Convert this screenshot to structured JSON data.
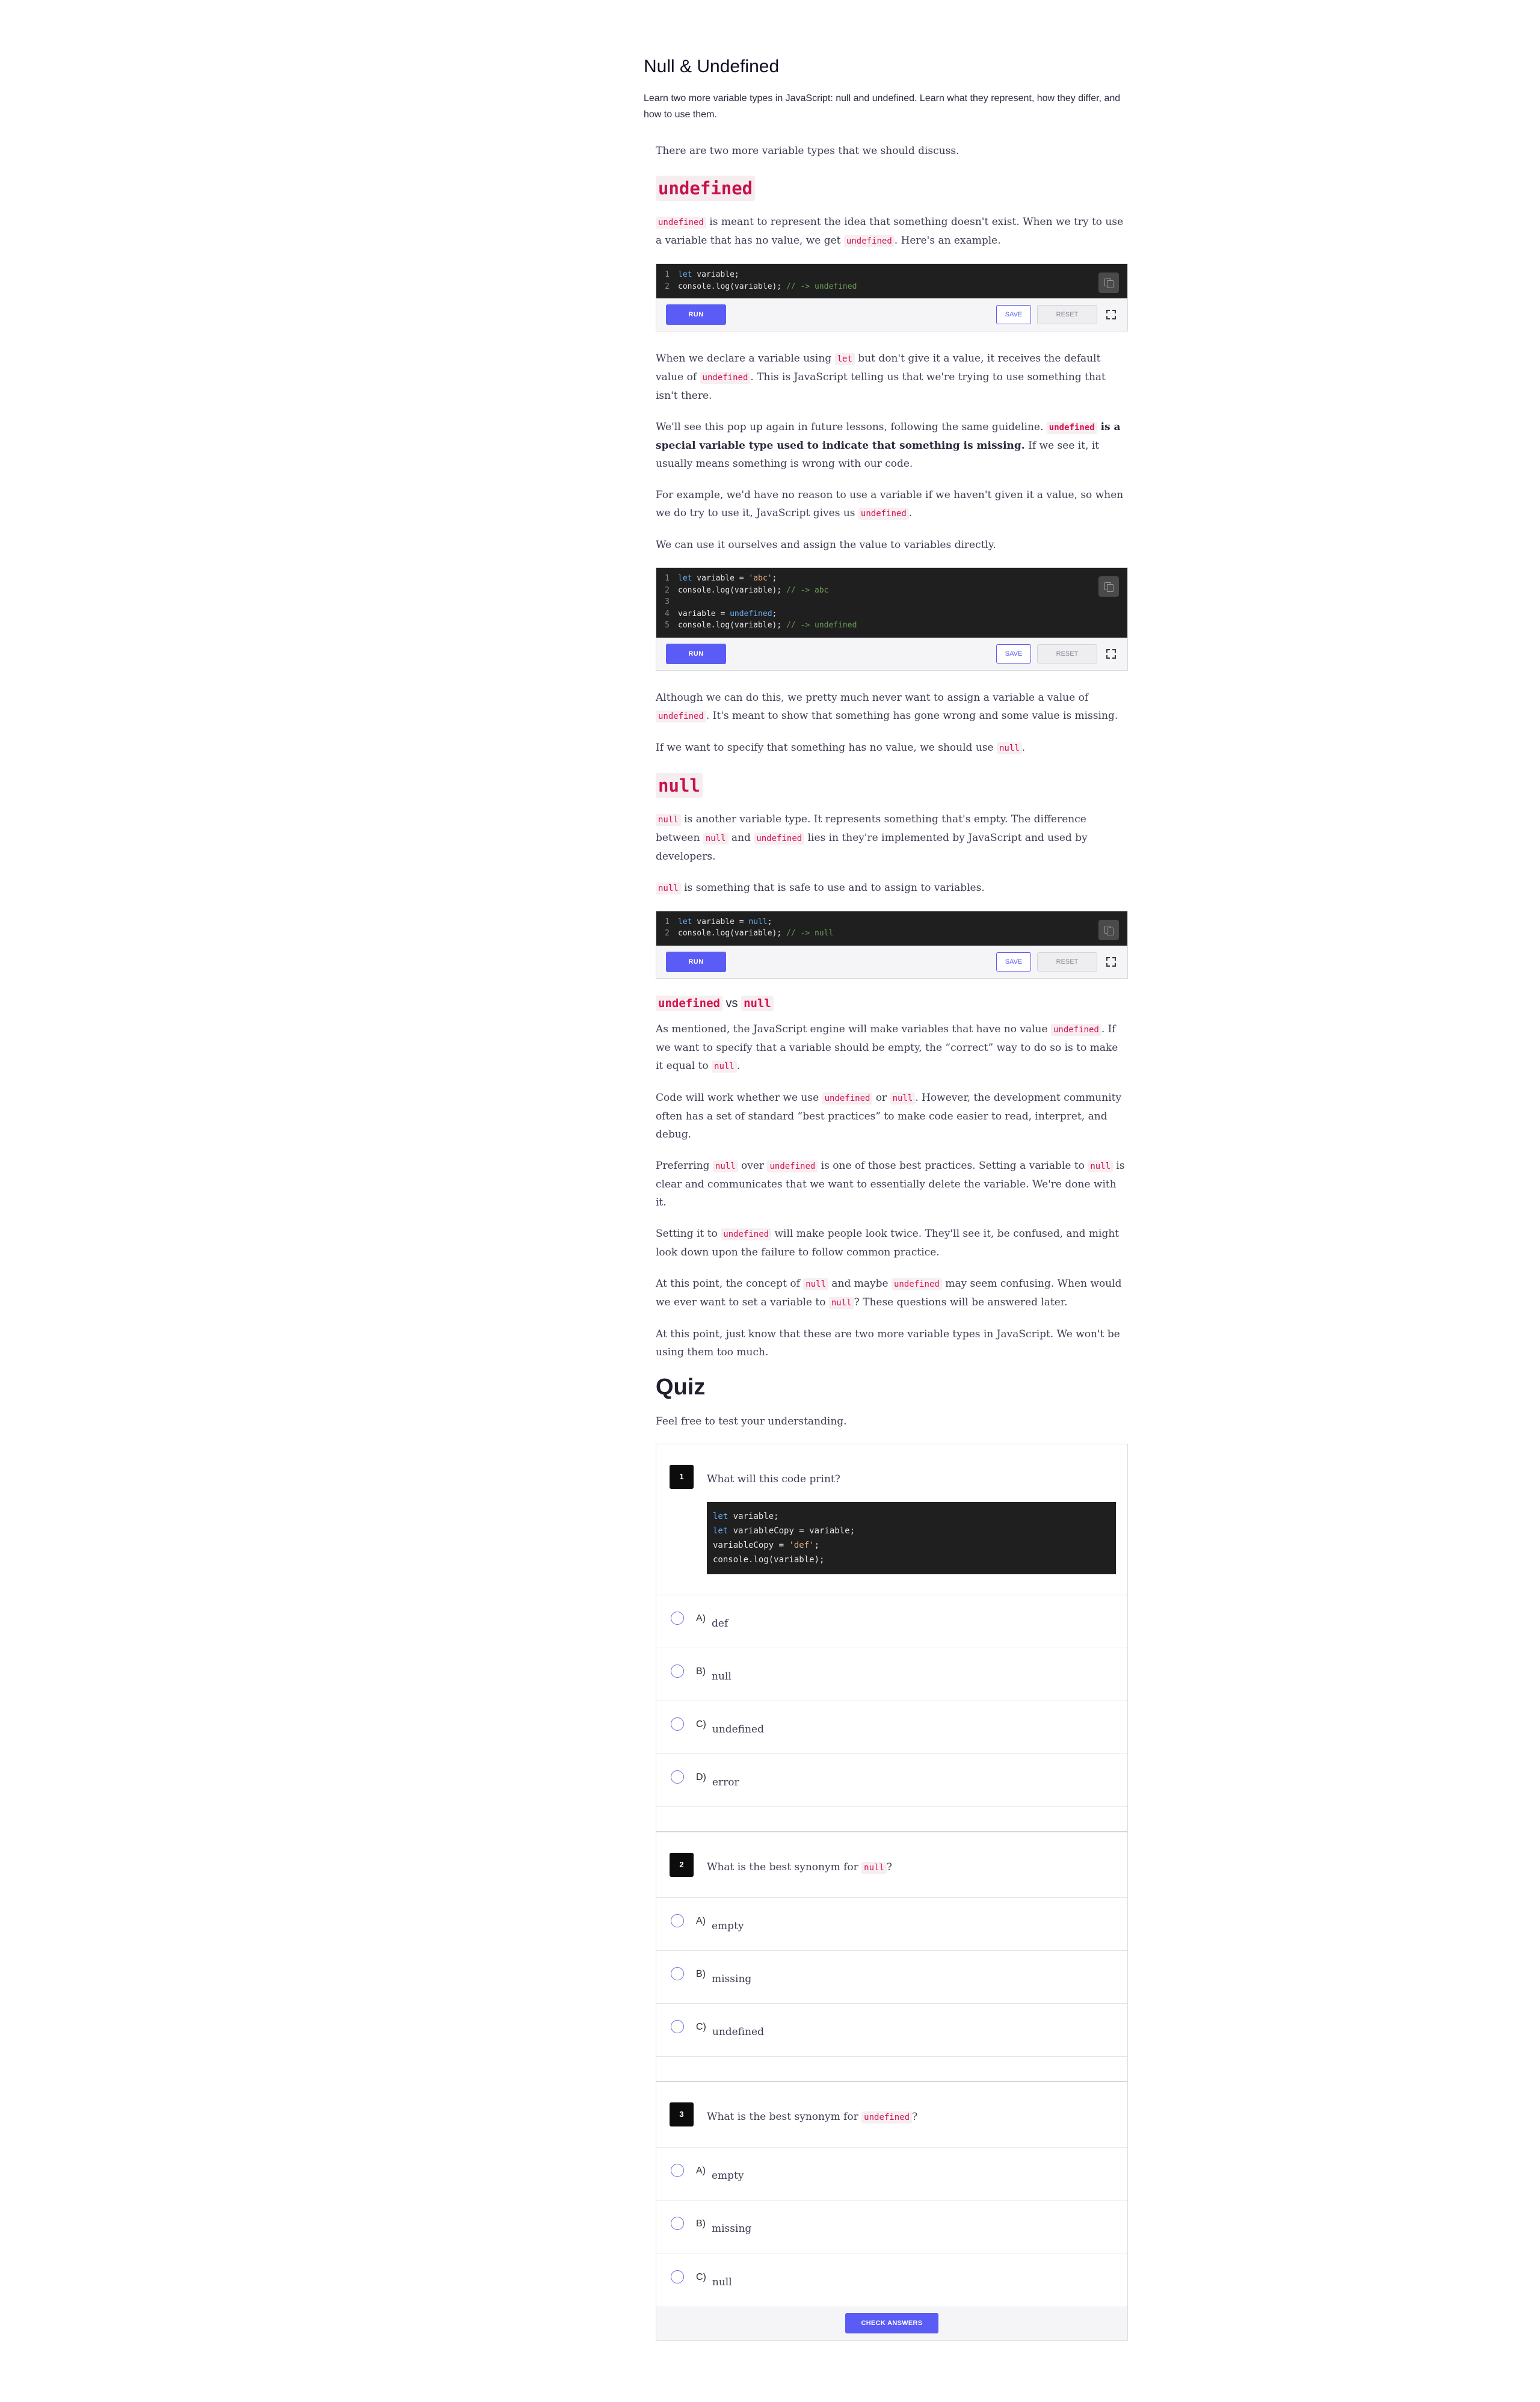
{
  "header": {
    "title": "Null & Undefined",
    "subtitle": "Learn two more variable types in JavaScript: null and undefined. Learn what they represent, how they differ, and how to use them."
  },
  "intro": "There are two more variable types that we should discuss.",
  "undefined_section": {
    "heading": "undefined",
    "p1": {
      "c1": "undefined",
      "t1": " is meant to represent the idea that something doesn't exist. When we try to use a variable that has no value, we get ",
      "c2": "undefined",
      "t2": ". Here's an example."
    }
  },
  "editor_labels": {
    "run": "RUN",
    "save": "SAVE",
    "reset": "RESET"
  },
  "editor1": {
    "lines": [
      {
        "n": "1",
        "kw": "let",
        "rest": " variable;",
        "cm": ""
      },
      {
        "n": "2",
        "kw": "",
        "rest": "console.log(variable); ",
        "cm": "// -> undefined"
      }
    ]
  },
  "paragraphs_a": {
    "p2": {
      "t1": "When we declare a variable using ",
      "c1": "let",
      "t2": " but don't give it a value, it receives the default value of ",
      "c2": "undefined",
      "t3": ". This is JavaScript telling us that we're trying to use something that isn't there."
    },
    "p3": {
      "t1": "We'll see this pop up again in future lessons, following the same guideline. ",
      "c1": "undefined",
      "b1": " is a special variable type used to indicate that something is missing.",
      "t2": " If we see it, it usually means something is wrong with our code."
    },
    "p4": {
      "t1": "For example, we'd have no reason to use a variable if we haven't given it a value, so when we do try to use it, JavaScript gives us ",
      "c1": "undefined",
      "t2": "."
    },
    "p5": "We can use it ourselves and assign the value to variables directly."
  },
  "editor2": {
    "l1": {
      "n": "1",
      "kw": "let",
      "a": " variable = ",
      "s": "'abc'",
      "b": ";"
    },
    "l2": {
      "n": "2",
      "a": "console.log(variable); ",
      "cm": "// -> abc"
    },
    "l3": {
      "n": "3"
    },
    "l4": {
      "n": "4",
      "a": "variable = ",
      "kw": "undefined",
      "b": ";"
    },
    "l5": {
      "n": "5",
      "a": "console.log(variable); ",
      "cm": "// -> undefined"
    }
  },
  "paragraphs_b": {
    "p6": {
      "t1": "Although we can do this, we pretty much never want to assign a variable a value of ",
      "c1": "undefined",
      "t2": ". It's meant to show that something has gone wrong and some value is missing."
    },
    "p7": {
      "t1": "If we want to specify that something has no value, we should use ",
      "c1": "null",
      "t2": "."
    }
  },
  "null_section": {
    "heading": "null",
    "p1": {
      "c1": "null",
      "t1": " is another variable type. It represents something that's empty. The difference between ",
      "c2": "null",
      "t2": " and ",
      "c3": "undefined",
      "t3": " lies in they're implemented by JavaScript and used by developers."
    },
    "p2": {
      "c1": "null",
      "t1": " is something that is safe to use and to assign to variables."
    }
  },
  "editor3": {
    "l1": {
      "n": "1",
      "kw": "let",
      "a": " variable = ",
      "kw2": "null",
      "b": ";"
    },
    "l2": {
      "n": "2",
      "a": "console.log(variable); ",
      "cm": "// -> null"
    }
  },
  "vs_section": {
    "c1": "undefined",
    "vs": " vs ",
    "c2": "null",
    "p1": {
      "t1": "As mentioned, the JavaScript engine will make variables that have no value ",
      "c1": "undefined",
      "t2": ". If we want to specify that a variable should be empty, the “correct” way to do so is to make it equal to ",
      "c2": "null",
      "t3": "."
    },
    "p2": {
      "t1": "Code will work whether we use ",
      "c1": "undefined",
      "t2": " or ",
      "c2": "null",
      "t3": ". However, the development community often has a set of standard “best practices” to make code easier to read, interpret, and debug."
    },
    "p3": {
      "t1": "Preferring ",
      "c1": "null",
      "t2": " over ",
      "c2": "undefined",
      "t3": " is one of those best practices. Setting a variable to ",
      "c3": "null",
      "t4": " is clear and communicates that we want to essentially delete the variable. We're done with it."
    },
    "p4": {
      "t1": "Setting it to ",
      "c1": "undefined",
      "t2": " will make people look twice. They'll see it, be confused, and might look down upon the failure to follow common practice."
    },
    "p5": {
      "t1": "At this point, the concept of ",
      "c1": "null",
      "t2": " and maybe ",
      "c2": "undefined",
      "t3": " may seem confusing. When would we ever want to set a variable to ",
      "c3": "null",
      "t4": "? These questions will be answered later."
    },
    "p6": "At this point, just know that these are two more variable types in JavaScript. We won't be using them too much."
  },
  "quiz": {
    "title": "Quiz",
    "intro": "Feel free to test your understanding.",
    "q1": {
      "num": "1",
      "text": "What will this code print?",
      "code": {
        "l1": {
          "kw": "let",
          "a": " variable;"
        },
        "l2": {
          "kw": "let",
          "a": " variableCopy = variable;"
        },
        "l3": {
          "a": "variableCopy = ",
          "s": "'def'",
          "b": ";"
        },
        "l4": {
          "a": "console.log(variable);"
        }
      },
      "options": [
        {
          "letter": "A)",
          "text": "def"
        },
        {
          "letter": "B)",
          "text": "null"
        },
        {
          "letter": "C)",
          "text": "undefined"
        },
        {
          "letter": "D)",
          "text": "error"
        }
      ]
    },
    "q2": {
      "num": "2",
      "t1": "What is the best synonym for ",
      "c1": "null",
      "t2": "?",
      "options": [
        {
          "letter": "A)",
          "text": "empty"
        },
        {
          "letter": "B)",
          "text": "missing"
        },
        {
          "letter": "C)",
          "text": "undefined"
        }
      ]
    },
    "q3": {
      "num": "3",
      "t1": "What is the best synonym for ",
      "c1": "undefined",
      "t2": "?",
      "options": [
        {
          "letter": "A)",
          "text": "empty"
        },
        {
          "letter": "B)",
          "text": "missing"
        },
        {
          "letter": "C)",
          "text": "null"
        }
      ]
    },
    "check_label": "CHECK ANSWERS"
  },
  "colors": {
    "accent": "#5b5bf6",
    "code_red": "#d6124f",
    "code_bg": "#1f1f1f"
  },
  "icons": [
    "copy-icon",
    "expand-icon",
    "radio-icon"
  ]
}
